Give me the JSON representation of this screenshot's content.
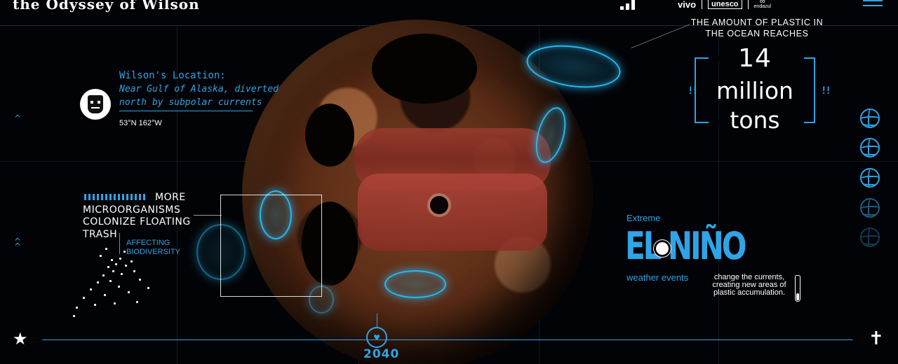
{
  "header": {
    "logo_text": "the Odyssey of Wilson",
    "partners": [
      "vivo",
      "unesco",
      "endazul"
    ]
  },
  "location": {
    "title": "Wilson's Location:",
    "description": "Near Gulf of Alaska, diverted north by subpolar currents",
    "coordinates": "53°N 162°W"
  },
  "side_arrows": [
    "^",
    "^\n^"
  ],
  "microorganisms": {
    "first_line": "MORE",
    "rest": "MICROORGANISMS COLONIZE FLOATING TRASH",
    "subtext": "AFFECTING BIODIVERSITY"
  },
  "plastic": {
    "caption": "THE AMOUNT OF PLASTIC IN THE OCEAN REACHES",
    "number": "14",
    "unit_line1": "million",
    "unit_line2": "tons",
    "excl_left": "!!",
    "excl_right": "!!"
  },
  "el_nino": {
    "label": "Extreme",
    "title": "EL NIÑO",
    "subtitle": "weather events",
    "description": "change the currents, creating new areas of plastic accumulation."
  },
  "timeline": {
    "year": "2040",
    "marker_icon": "heart-icon",
    "left_icon": "star-icon",
    "right_icon": "cross-icon"
  },
  "ball_icons": [
    "ball-icon",
    "ball-icon",
    "ball-icon",
    "ball-icon",
    "ball-icon"
  ],
  "colors": {
    "accent": "#2fa4e7",
    "background": "#020306",
    "text": "#ffffff"
  }
}
